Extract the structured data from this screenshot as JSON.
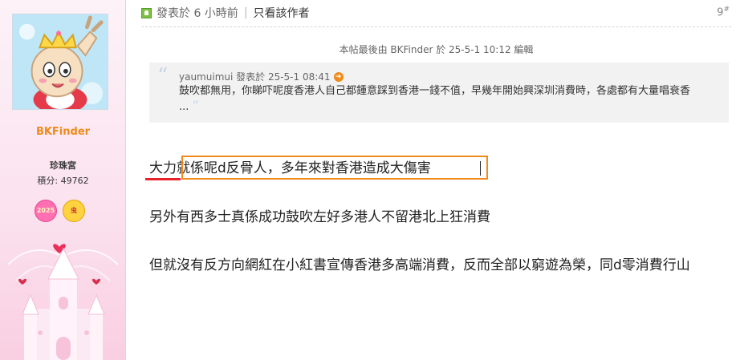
{
  "author": {
    "username": "BKFinder",
    "group": "珍珠宮",
    "points": "積分: 49762",
    "badges": [
      "2025",
      "虫"
    ]
  },
  "post": {
    "posted_time": "發表於 6 小時前",
    "only_author_link": "只看該作者",
    "floor": "9",
    "floor_symbol": "#",
    "edit_note": "本帖最後由 BKFinder 於 25-5-1 10:12 編輯",
    "quote": {
      "open_mark": "“",
      "meta": "yaumuimui 發表於 25-5-1 08:41",
      "goto_icon": "arrow-right-icon",
      "text": "鼓吹都無用，你睇吓呢度香港人自己都鍾意踩到香港一錢不值，早幾年開始興深圳消費時，各處都有大量唱衰香 ...",
      "close_mark": "”"
    },
    "paragraph1_prefix": "大力",
    "paragraph1_rest": "就係呢d反骨人，多年來對香港造成大傷害",
    "paragraph2": "另外有西多士真係成功鼓吹左好多港人不留港北上狂消費",
    "paragraph3": "但就沒有反方向網紅在小紅書宣傳香港多高端消費，反而全部以窮遊為榮，同d零消費行山"
  },
  "colors": {
    "username": "#f08a1c",
    "annotation_underline": "#e8202a",
    "annotation_box": "#f08a1c",
    "online_icon": "#7bc043"
  }
}
